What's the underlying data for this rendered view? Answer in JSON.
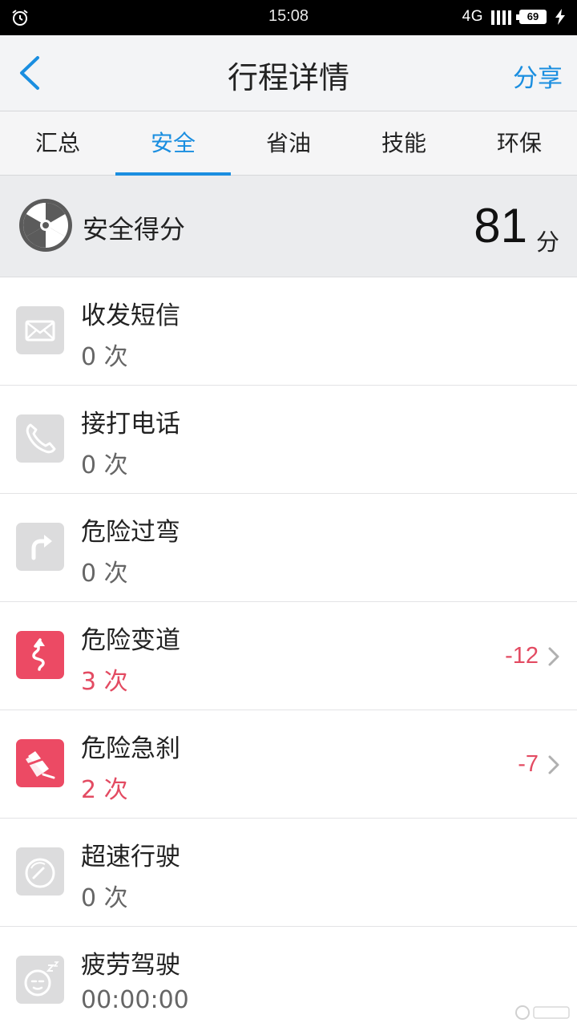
{
  "status_bar": {
    "time": "15:08",
    "network": "4G",
    "battery": "69",
    "icons": [
      "alarm-icon",
      "signal-icon",
      "battery-icon",
      "charging-icon"
    ]
  },
  "header": {
    "title": "行程详情",
    "share_label": "分享",
    "back_icon": "chevron-left-icon"
  },
  "tabs": [
    {
      "label": "汇总",
      "active": false
    },
    {
      "label": "安全",
      "active": true
    },
    {
      "label": "省油",
      "active": false
    },
    {
      "label": "技能",
      "active": false
    },
    {
      "label": "环保",
      "active": false
    }
  ],
  "score": {
    "label": "安全得分",
    "value": "81",
    "unit": "分",
    "icon": "radiation-icon"
  },
  "items": [
    {
      "title": "收发短信",
      "count": "0 次",
      "icon": "message-icon",
      "alert": false
    },
    {
      "title": "接打电话",
      "count": "0 次",
      "icon": "phone-icon",
      "alert": false
    },
    {
      "title": "危险过弯",
      "count": "0 次",
      "icon": "turn-icon",
      "alert": false
    },
    {
      "title": "危险变道",
      "count": "3 次",
      "icon": "lane-change-icon",
      "alert": true,
      "penalty": "-12"
    },
    {
      "title": "危险急刹",
      "count": "2 次",
      "icon": "brake-icon",
      "alert": true,
      "penalty": "-7"
    },
    {
      "title": "超速行驶",
      "count": "0 次",
      "icon": "speedometer-icon",
      "alert": false
    },
    {
      "title": "疲劳驾驶",
      "count": "00:00:00",
      "icon": "sleepy-face-icon",
      "alert": false
    }
  ],
  "colors": {
    "accent": "#1a8ee0",
    "alert": "#e34b62",
    "alert_icon_bg": "#ec4a64",
    "icon_bg": "#dcdcdd",
    "score_bg": "#ebecee"
  }
}
